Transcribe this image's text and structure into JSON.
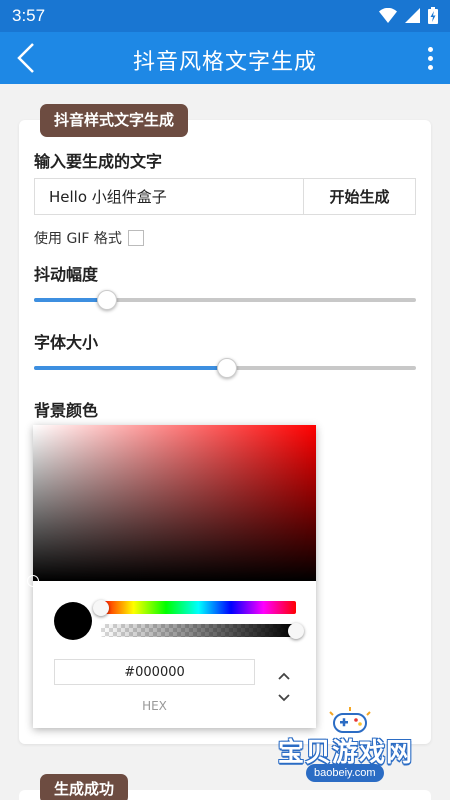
{
  "status_bar": {
    "time": "3:57"
  },
  "app_bar": {
    "title": "抖音风格文字生成"
  },
  "generator_card": {
    "tag": "抖音样式文字生成",
    "input_label": "输入要生成的文字",
    "input_value": "Hello 小组件盒子",
    "generate_button": "开始生成",
    "gif_option_label": "使用 GIF 格式",
    "gif_checked": false,
    "shake_label": "抖动幅度",
    "shake_value": 0.19,
    "font_size_label": "字体大小",
    "font_size_value": 0.505,
    "bg_color_label": "背景颜色"
  },
  "color_picker": {
    "hex_value": "#000000",
    "mode_label": "HEX",
    "hue_position": 0.0,
    "alpha_position": 1.0
  },
  "result_card": {
    "tag": "生成成功"
  },
  "watermark": {
    "text": "宝贝游戏网",
    "domain": "baobeiy.com"
  }
}
